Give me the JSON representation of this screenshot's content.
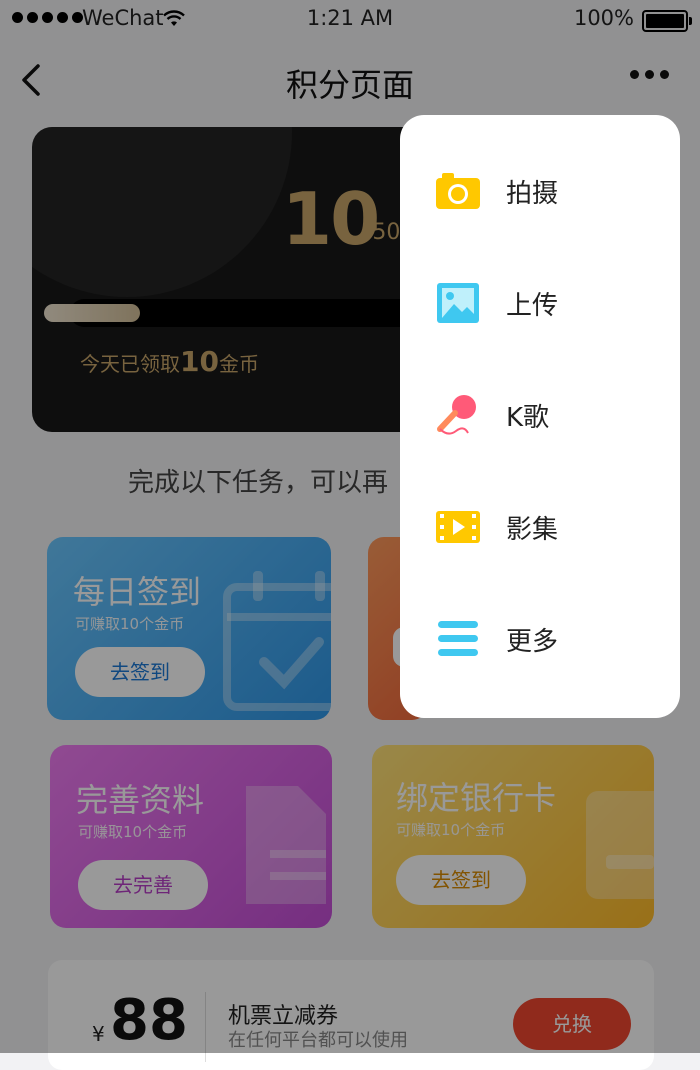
{
  "status_bar": {
    "carrier": "WeChat",
    "time": "1:21 AM",
    "battery": "100%"
  },
  "nav": {
    "title": "积分页面"
  },
  "points_card": {
    "points": "10",
    "max": "/50",
    "progress_fraction": 0.2,
    "today_prefix": "今天已领取",
    "today_amount": "10",
    "today_suffix": "金币"
  },
  "subtitle": "完成以下任务，可以再",
  "tasks": [
    {
      "title": "每日签到",
      "sub": "可赚取10个金币",
      "button": "去签到"
    },
    {
      "title": "完善资料",
      "sub": "可赚取10个金币",
      "button": "去完善"
    },
    {
      "title": "绑定银行卡",
      "sub": "可赚取10个金币",
      "button": "去签到"
    }
  ],
  "coupon": {
    "currency": "¥",
    "amount": "88",
    "title": "机票立减券",
    "subtitle": "在任何平台都可以使用",
    "button": "兑换"
  },
  "menu": {
    "items": [
      {
        "label": "拍摄",
        "icon": "camera-icon",
        "color": "#FFC800"
      },
      {
        "label": "上传",
        "icon": "image-upload-icon",
        "color": "#3FC8F0"
      },
      {
        "label": "K歌",
        "icon": "microphone-icon",
        "color": "#FF5A78"
      },
      {
        "label": "影集",
        "icon": "film-icon",
        "color": "#FFC800"
      },
      {
        "label": "更多",
        "icon": "more-lines-icon",
        "color": "#3FC8F0"
      }
    ]
  },
  "colors": {
    "gold": "#c8a66a",
    "coupon_button": "#f0472f"
  }
}
